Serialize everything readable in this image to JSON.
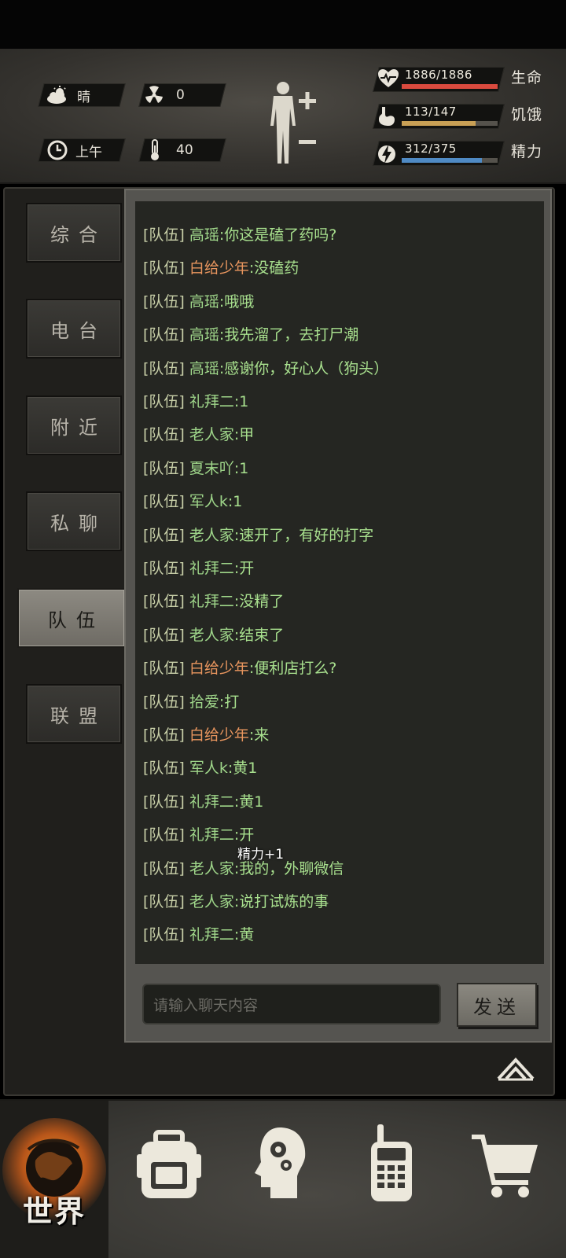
{
  "hud": {
    "weather": "晴",
    "radiation": "0",
    "time_of_day": "上午",
    "temperature": "40",
    "stats": [
      {
        "value": "1886/1886",
        "label": "生命",
        "fraction": 1.0,
        "color": "#d94a3e",
        "icon": "heart-pulse-icon"
      },
      {
        "value": "113/147",
        "label": "饥饿",
        "fraction": 0.769,
        "color": "#c9a055",
        "icon": "stomach-icon"
      },
      {
        "value": "312/375",
        "label": "精力",
        "fraction": 0.832,
        "color": "#4f8ac4",
        "icon": "energy-bolt-icon"
      }
    ]
  },
  "tabs": [
    {
      "label": "综合",
      "active": false
    },
    {
      "label": "电台",
      "active": false
    },
    {
      "label": "附近",
      "active": false
    },
    {
      "label": "私聊",
      "active": false
    },
    {
      "label": "队伍",
      "active": true
    },
    {
      "label": "联盟",
      "active": false
    }
  ],
  "chat": {
    "messages": [
      {
        "channel": "[队伍]",
        "sender": "高瑶",
        "text": ":你这是磕了药吗?",
        "highlight": false
      },
      {
        "channel": "[队伍]",
        "sender": "白给少年",
        "text": ":没磕药",
        "highlight": true
      },
      {
        "channel": "[队伍]",
        "sender": "高瑶",
        "text": ":哦哦",
        "highlight": false
      },
      {
        "channel": "[队伍]",
        "sender": "高瑶",
        "text": ":我先溜了，去打尸潮",
        "highlight": false
      },
      {
        "channel": "[队伍]",
        "sender": "高瑶",
        "text": ":感谢你，好心人（狗头）",
        "highlight": false
      },
      {
        "channel": "[队伍]",
        "sender": "礼拜二",
        "text": ":1",
        "highlight": false
      },
      {
        "channel": "[队伍]",
        "sender": "老人家",
        "text": ":甲",
        "highlight": false
      },
      {
        "channel": "[队伍]",
        "sender": "夏末吖",
        "text": ":1",
        "highlight": false
      },
      {
        "channel": "[队伍]",
        "sender": "军人k",
        "text": ":1",
        "highlight": false
      },
      {
        "channel": "[队伍]",
        "sender": "老人家",
        "text": ":速开了，有好的打字",
        "highlight": false
      },
      {
        "channel": "[队伍]",
        "sender": "礼拜二",
        "text": ":开",
        "highlight": false
      },
      {
        "channel": "[队伍]",
        "sender": "礼拜二",
        "text": ":没精了",
        "highlight": false
      },
      {
        "channel": "[队伍]",
        "sender": "老人家",
        "text": ":结束了",
        "highlight": false
      },
      {
        "channel": "[队伍]",
        "sender": "白给少年",
        "text": ":便利店打么?",
        "highlight": true
      },
      {
        "channel": "[队伍]",
        "sender": "拾爱",
        "text": ":打",
        "highlight": false
      },
      {
        "channel": "[队伍]",
        "sender": "白给少年",
        "text": ":来",
        "highlight": true
      },
      {
        "channel": "[队伍]",
        "sender": "军人k",
        "text": ":黄1",
        "highlight": false
      },
      {
        "channel": "[队伍]",
        "sender": "礼拜二",
        "text": ":黄1",
        "highlight": false
      },
      {
        "channel": "[队伍]",
        "sender": "礼拜二",
        "text": ":开",
        "highlight": false
      },
      {
        "channel": "[队伍]",
        "sender": "老人家",
        "text": ":我的，外聊微信",
        "highlight": false
      },
      {
        "channel": "[队伍]",
        "sender": "老人家",
        "text": ":说打试炼的事",
        "highlight": false
      },
      {
        "channel": "[队伍]",
        "sender": "礼拜二",
        "text": ":黄",
        "highlight": false
      }
    ],
    "floating_text": "精力+1",
    "input_placeholder": "请输入聊天内容",
    "send_label": "发送"
  },
  "nav": {
    "world_label": "世界",
    "items": [
      "globe-icon",
      "backpack-icon",
      "head-gears-icon",
      "walkie-talkie-icon",
      "shopping-cart-icon"
    ]
  }
}
